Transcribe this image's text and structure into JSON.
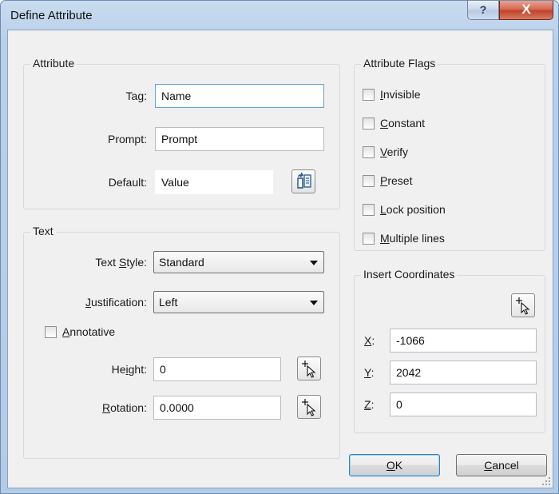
{
  "window": {
    "title": "Define Attribute",
    "help_label": "?",
    "close_label": "X"
  },
  "attribute": {
    "legend": "Attribute",
    "tag_label": "Tag:",
    "tag_value": "Name",
    "prompt_label": "Prompt:",
    "prompt_value": "Prompt",
    "default_label": "Default:",
    "default_value": "Value"
  },
  "text": {
    "legend": "Text",
    "style_label_pre": "Text ",
    "style_label_u": "S",
    "style_label_post": "tyle:",
    "style_value": "Standard",
    "just_label_pre": "",
    "just_label_u": "J",
    "just_label_post": "ustification:",
    "just_value": "Left",
    "annotative_u": "A",
    "annotative_post": "nnotative",
    "height_label_pre": "He",
    "height_label_u": "i",
    "height_label_post": "ght:",
    "height_value": "0",
    "rotation_label_pre": "",
    "rotation_label_u": "R",
    "rotation_label_post": "otation:",
    "rotation_value": "0.0000"
  },
  "flags": {
    "legend": "Attribute Flags",
    "items": [
      {
        "u": "I",
        "rest": "nvisible",
        "checked": false
      },
      {
        "u": "C",
        "rest": "onstant",
        "checked": false
      },
      {
        "u": "V",
        "rest": "erify",
        "checked": false
      },
      {
        "u": "P",
        "rest": "reset",
        "checked": false
      },
      {
        "u": "L",
        "rest": "ock position",
        "checked": false
      },
      {
        "u": "M",
        "rest": "ultiple lines",
        "checked": false
      }
    ]
  },
  "coords": {
    "legend": "Insert Coordinates",
    "x_u": "X",
    "x_post": ":",
    "x_value": "-1066",
    "y_u": "Y",
    "y_post": ":",
    "y_value": "2042",
    "z_u": "Z",
    "z_post": ":",
    "z_value": "0"
  },
  "buttons": {
    "ok_u": "O",
    "ok_post": "K",
    "cancel_u": "C",
    "cancel_post": "ancel"
  },
  "icons": {
    "pick": "pick-point-icon",
    "field": "insert-field-icon"
  }
}
